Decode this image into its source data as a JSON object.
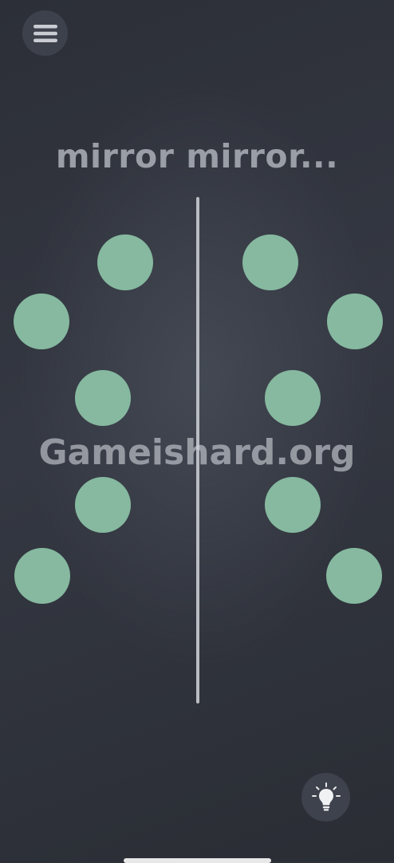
{
  "header": {
    "menu_icon": "hamburger-menu-icon"
  },
  "puzzle": {
    "title": "mirror mirror...",
    "dot_color": "#86b9a0",
    "left_dots": 5,
    "right_dots": 5
  },
  "watermark": {
    "text": "Gameishard.org"
  },
  "footer": {
    "hint_icon": "lightbulb-icon"
  },
  "colors": {
    "background": "#2f333b",
    "title": "#9a9ea6",
    "mirror_line": "#b9bcc2",
    "button_bg": "#3e424c"
  }
}
